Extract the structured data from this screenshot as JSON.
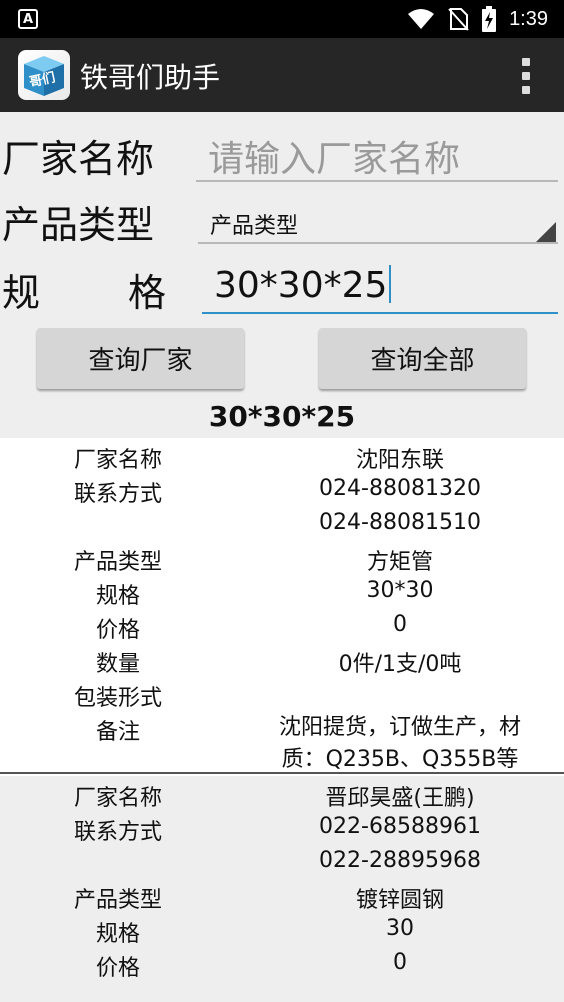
{
  "status_bar": {
    "time": "1:39",
    "app_indicator": "A"
  },
  "app_bar": {
    "title": "铁哥们助手",
    "icon_text": "哥们"
  },
  "form": {
    "manufacturer_label": "厂家名称",
    "manufacturer_placeholder": "请输入厂家名称",
    "product_type_label": "产品类型",
    "product_type_selected": "产品类型",
    "spec_label_left": "规",
    "spec_label_right": "格",
    "spec_value": "30*30*25"
  },
  "buttons": {
    "query_manufacturer": "查询厂家",
    "query_all": "查询全部"
  },
  "result_title": "30*30*25",
  "records": [
    {
      "background": "#ffffff",
      "rows": [
        {
          "label": "厂家名称",
          "value": "沈阳东联"
        },
        {
          "label": "联系方式",
          "value": "024-88081320"
        },
        {
          "label": "",
          "value": "024-88081510"
        },
        {
          "label": "产品类型",
          "value": "方矩管"
        },
        {
          "label": "规格",
          "value": "30*30"
        },
        {
          "label": "价格",
          "value": "0"
        },
        {
          "label": "数量",
          "value": "0件/1支/0吨"
        },
        {
          "label": "包装形式",
          "value": ""
        },
        {
          "label": "备注",
          "value": "沈阳提货，订做生产，材质：Q235B、Q355B等"
        }
      ]
    },
    {
      "background": "#eeeeee",
      "rows": [
        {
          "label": "厂家名称",
          "value": "晋邱昊盛(王鹏)"
        },
        {
          "label": "联系方式",
          "value": "022-68588961"
        },
        {
          "label": "",
          "value": "022-28895968"
        },
        {
          "label": "产品类型",
          "value": "镀锌圆钢"
        },
        {
          "label": "规格",
          "value": "30"
        },
        {
          "label": "价格",
          "value": "0"
        }
      ]
    }
  ],
  "colors": {
    "accent": "#2f8fc9",
    "app_bar": "#262626",
    "status_bar": "#000000",
    "background": "#eeeeee"
  }
}
